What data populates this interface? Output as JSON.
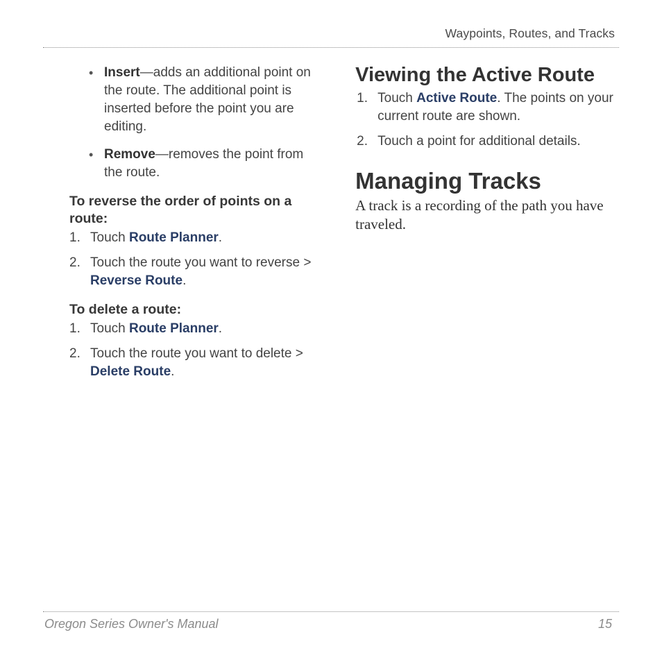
{
  "header": {
    "section_title": "Waypoints, Routes, and Tracks"
  },
  "left": {
    "bullets": [
      {
        "term": "Insert",
        "text": "—adds an additional point on the route. The additional point is inserted before the point you are editing."
      },
      {
        "term": "Remove",
        "text": "—removes the point from the route."
      }
    ],
    "reverse": {
      "heading": "To reverse the order of points on a route:",
      "step1_prefix": "Touch ",
      "step1_link": "Route Planner",
      "step1_suffix": ".",
      "step2_prefix": "Touch the route you want to reverse > ",
      "step2_link": "Reverse Route",
      "step2_suffix": "."
    },
    "delete": {
      "heading": "To delete a route:",
      "step1_prefix": "Touch ",
      "step1_link": "Route Planner",
      "step1_suffix": ".",
      "step2_prefix": "Touch the route you want to delete > ",
      "step2_link": "Delete Route",
      "step2_suffix": "."
    }
  },
  "right": {
    "viewing": {
      "heading": "Viewing the Active Route",
      "step1_prefix": "Touch ",
      "step1_link": "Active Route",
      "step1_suffix": ". The points on your current route are shown.",
      "step2": "Touch a point for additional details."
    },
    "managing": {
      "heading": "Managing Tracks",
      "body": "A track is a recording of the path you have traveled."
    }
  },
  "footer": {
    "manual": "Oregon Series Owner's Manual",
    "page": "15"
  }
}
